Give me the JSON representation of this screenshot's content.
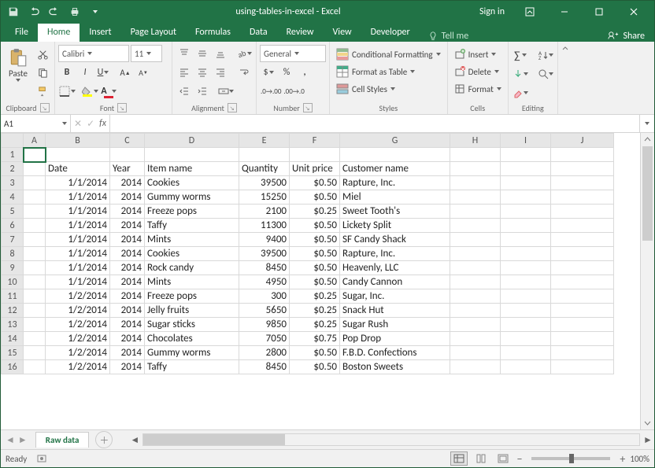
{
  "title": "using-tables-in-excel - Excel",
  "signin": "Sign in",
  "tabs": [
    "File",
    "Home",
    "Insert",
    "Page Layout",
    "Formulas",
    "Data",
    "Review",
    "View",
    "Developer"
  ],
  "tellme": "Tell me",
  "share": "Share",
  "ribbon": {
    "clipboard": {
      "paste": "Paste",
      "label": "Clipboard"
    },
    "font": {
      "name": "Calibri",
      "size": "11",
      "label": "Font"
    },
    "alignment": {
      "label": "Alignment"
    },
    "number": {
      "format": "General",
      "label": "Number"
    },
    "styles": {
      "cond": "Conditional Formatting",
      "table": "Format as Table",
      "cell": "Cell Styles",
      "label": "Styles"
    },
    "cells": {
      "insert": "Insert",
      "delete": "Delete",
      "format": "Format",
      "label": "Cells"
    },
    "editing": {
      "label": "Editing"
    }
  },
  "namebox": "A1",
  "fx_label": "fx",
  "columns": [
    "A",
    "B",
    "C",
    "D",
    "E",
    "F",
    "G",
    "H",
    "I",
    "J"
  ],
  "col_widths": [
    "colA",
    "colB",
    "colC",
    "colD",
    "colE",
    "colF",
    "colG",
    "colH",
    "colI",
    "colJ"
  ],
  "headers_row": 2,
  "headers": {
    "B": "Date",
    "C": "Year",
    "D": "Item name",
    "E": "Quantity",
    "F": "Unit price",
    "G": "Customer name"
  },
  "rows": [
    {
      "n": 1
    },
    {
      "n": 2,
      "B": "Date",
      "C": "Year",
      "D": "Item name",
      "E": "Quantity",
      "F": "Unit price",
      "G": "Customer name"
    },
    {
      "n": 3,
      "B": "1/1/2014",
      "C": "2014",
      "D": "Cookies",
      "E": "39500",
      "F": "$0.50",
      "G": "Rapture, Inc."
    },
    {
      "n": 4,
      "B": "1/1/2014",
      "C": "2014",
      "D": "Gummy worms",
      "E": "15250",
      "F": "$0.50",
      "G": "Miel"
    },
    {
      "n": 5,
      "B": "1/1/2014",
      "C": "2014",
      "D": "Freeze pops",
      "E": "2100",
      "F": "$0.25",
      "G": "Sweet Tooth's"
    },
    {
      "n": 6,
      "B": "1/1/2014",
      "C": "2014",
      "D": "Taffy",
      "E": "11300",
      "F": "$0.50",
      "G": "Lickety Split"
    },
    {
      "n": 7,
      "B": "1/1/2014",
      "C": "2014",
      "D": "Mints",
      "E": "9400",
      "F": "$0.50",
      "G": "SF Candy Shack"
    },
    {
      "n": 8,
      "B": "1/1/2014",
      "C": "2014",
      "D": "Cookies",
      "E": "39500",
      "F": "$0.50",
      "G": "Rapture, Inc."
    },
    {
      "n": 9,
      "B": "1/1/2014",
      "C": "2014",
      "D": "Rock candy",
      "E": "8450",
      "F": "$0.50",
      "G": "Heavenly, LLC"
    },
    {
      "n": 10,
      "B": "1/1/2014",
      "C": "2014",
      "D": "Mints",
      "E": "4950",
      "F": "$0.50",
      "G": "Candy Cannon"
    },
    {
      "n": 11,
      "B": "1/2/2014",
      "C": "2014",
      "D": "Freeze pops",
      "E": "300",
      "F": "$0.25",
      "G": "Sugar, Inc."
    },
    {
      "n": 12,
      "B": "1/2/2014",
      "C": "2014",
      "D": "Jelly fruits",
      "E": "5650",
      "F": "$0.25",
      "G": "Snack Hut"
    },
    {
      "n": 13,
      "B": "1/2/2014",
      "C": "2014",
      "D": "Sugar sticks",
      "E": "9850",
      "F": "$0.25",
      "G": "Sugar Rush"
    },
    {
      "n": 14,
      "B": "1/2/2014",
      "C": "2014",
      "D": "Chocolates",
      "E": "7050",
      "F": "$0.75",
      "G": "Pop Drop"
    },
    {
      "n": 15,
      "B": "1/2/2014",
      "C": "2014",
      "D": "Gummy worms",
      "E": "2800",
      "F": "$0.50",
      "G": "F.B.D. Confections"
    },
    {
      "n": 16,
      "B": "1/2/2014",
      "C": "2014",
      "D": "Taffy",
      "E": "8450",
      "F": "$0.50",
      "G": "Boston Sweets"
    }
  ],
  "sheet_tab": "Raw data",
  "status": "Ready",
  "zoom": "100%"
}
